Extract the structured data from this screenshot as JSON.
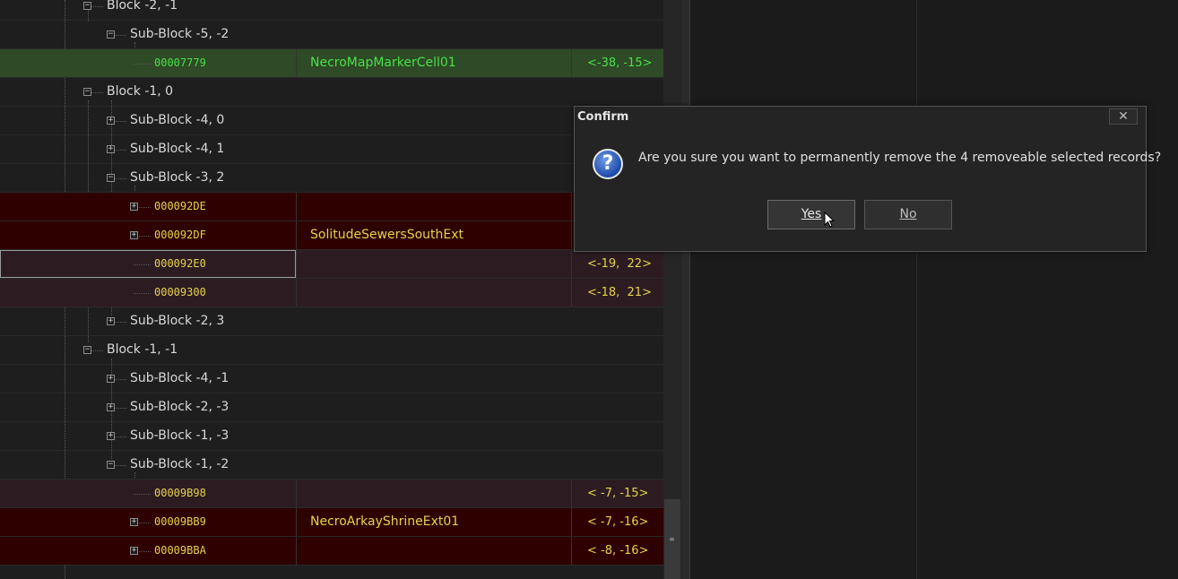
{
  "tree": {
    "rows": [
      {
        "type": "block",
        "label": "Block -2, -1",
        "expander": "−"
      },
      {
        "type": "subblock",
        "label": "Sub-Block -5, -2",
        "expander": "−"
      },
      {
        "type": "record",
        "formid": "00007779",
        "name": "NecroMapMarkerCell01",
        "coord": "<-38, -15>",
        "status": "green"
      },
      {
        "type": "block",
        "label": "Block -1, 0",
        "expander": "−"
      },
      {
        "type": "subblock",
        "label": "Sub-Block -4, 0",
        "expander": "+"
      },
      {
        "type": "subblock",
        "label": "Sub-Block -4, 1",
        "expander": "+"
      },
      {
        "type": "subblock",
        "label": "Sub-Block -3, 2",
        "expander": "−"
      },
      {
        "type": "record",
        "formid": "000092DE",
        "name": "",
        "coord": "",
        "status": "red",
        "expander": "+"
      },
      {
        "type": "record",
        "formid": "000092DF",
        "name": "SolitudeSewersSouthExt",
        "coord": "",
        "status": "red",
        "expander": "+"
      },
      {
        "type": "record",
        "formid": "000092E0",
        "name": "",
        "coord": "<-19,  22>",
        "status": "pink",
        "focused": true
      },
      {
        "type": "record",
        "formid": "00009300",
        "name": "",
        "coord": "<-18,  21>",
        "status": "pink"
      },
      {
        "type": "subblock",
        "label": "Sub-Block -2, 3",
        "expander": "+"
      },
      {
        "type": "block",
        "label": "Block -1, -1",
        "expander": "−"
      },
      {
        "type": "subblock",
        "label": "Sub-Block -4, -1",
        "expander": "+"
      },
      {
        "type": "subblock",
        "label": "Sub-Block -2, -3",
        "expander": "+"
      },
      {
        "type": "subblock",
        "label": "Sub-Block -1, -3",
        "expander": "+"
      },
      {
        "type": "subblock",
        "label": "Sub-Block -1, -2",
        "expander": "−"
      },
      {
        "type": "record",
        "formid": "00009B98",
        "name": "",
        "coord": "< -7, -15>",
        "status": "pink"
      },
      {
        "type": "record",
        "formid": "00009BB9",
        "name": "NecroArkayShrineExt01",
        "coord": "< -7, -16>",
        "status": "red",
        "expander": "+"
      },
      {
        "type": "record",
        "formid": "00009BBA",
        "name": "",
        "coord": "< -8, -16>",
        "status": "red",
        "expander": "+"
      }
    ]
  },
  "dialog": {
    "title": "Confirm",
    "close_glyph": "✕",
    "icon": "question-icon",
    "icon_glyph": "?",
    "message": "Are you sure you want to permanently remove the 4 removeable selected records?",
    "yes_label": "Yes",
    "no_label": "No"
  },
  "scrollbar": {
    "grip_glyph": "≡"
  },
  "colors": {
    "background": "#1e1e1e",
    "green_row": "#2e4a26",
    "green_text": "#48e048",
    "red_row": "#2e0000",
    "pink_row": "#2c1c22",
    "record_text": "#e6d24a"
  }
}
